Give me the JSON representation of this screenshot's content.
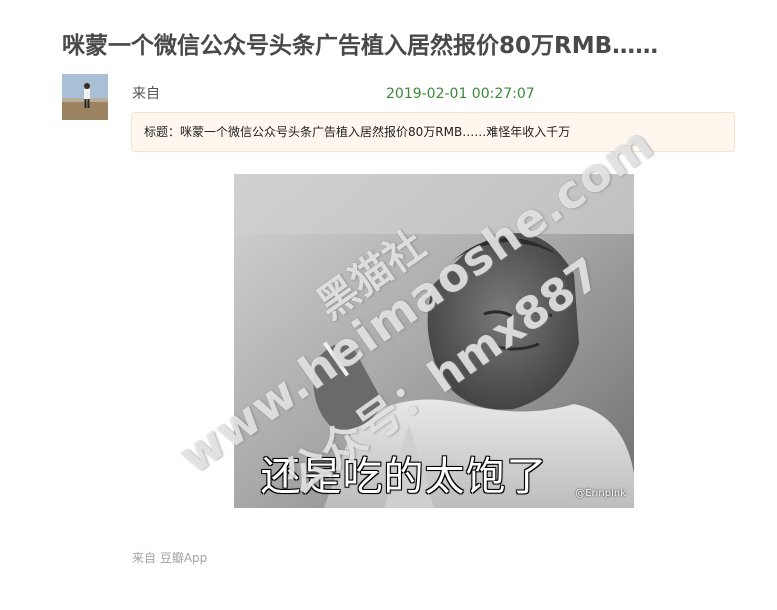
{
  "post": {
    "title": "咪蒙一个微信公众号头条广告植入居然报价80万RMB……",
    "author_from": "来自",
    "time": "2019-02-01 00:27:07",
    "quote": "标题：咪蒙一个微信公众号头条广告植入居然报价80万RMB……难怪年收入千万",
    "footer_from": "来自  豆瓣App"
  },
  "meme": {
    "caption": "还是吃的太饱了",
    "credit": "@Erinpink"
  },
  "watermark": {
    "line1": "黑猫社",
    "line2": "www.heimaoshe.com",
    "line3": "公众号：hmx887"
  },
  "colors": {
    "time_green": "#3b8a3b",
    "quote_bg": "#fff6ee",
    "title_gray": "#494949"
  }
}
